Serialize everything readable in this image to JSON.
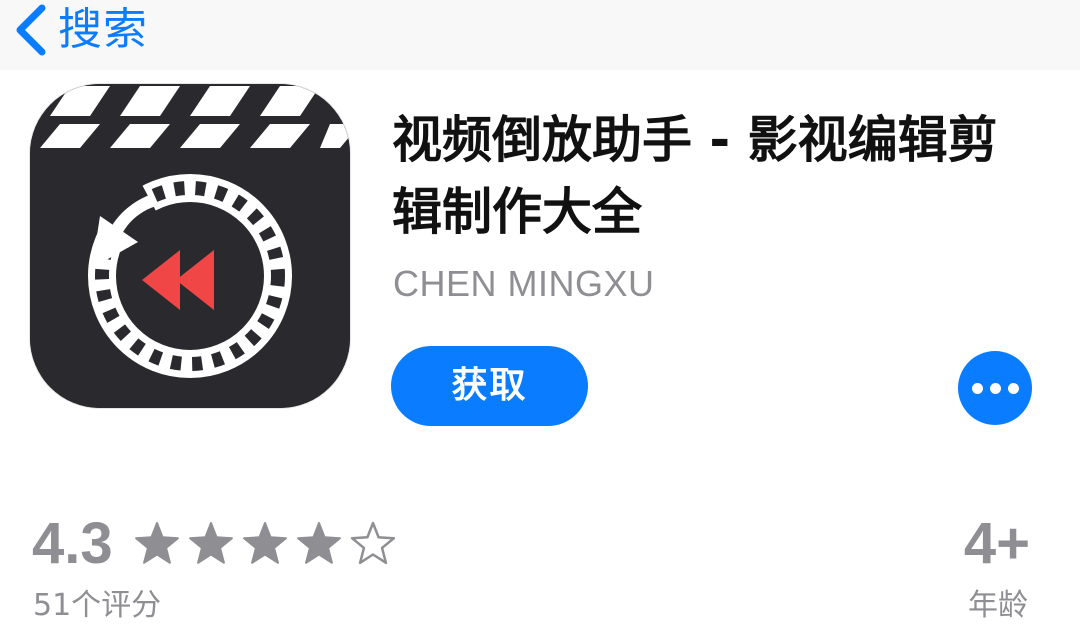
{
  "nav": {
    "back_label": "搜索"
  },
  "app": {
    "title": "视频倒放助手 - 影视编辑剪辑制作大全",
    "developer": "CHEN MINGXU",
    "get_label": "获取",
    "icon_name": "video-reverse-app-icon"
  },
  "ratings": {
    "value": "4.3",
    "stars_filled": 4,
    "stars_total": 5,
    "count_label": "51个评分"
  },
  "age": {
    "value": "4+",
    "label": "年龄"
  },
  "colors": {
    "accent": "#0a7cff",
    "secondary_text": "#8e8e93",
    "icon_background": "#2a2a2e",
    "icon_play": "#f04646"
  }
}
